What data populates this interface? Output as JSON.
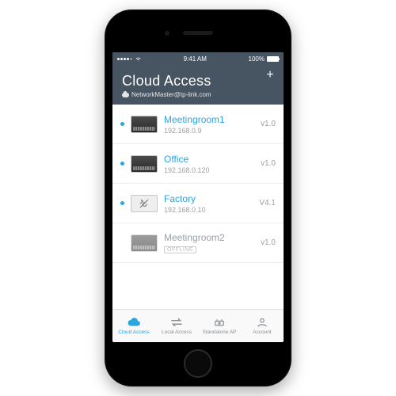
{
  "statusbar": {
    "time": "9:41 AM",
    "battery": "100%"
  },
  "header": {
    "title": "Cloud Access",
    "subtitle": "NetworkMaster@tp-link.com"
  },
  "devices": [
    {
      "name": "Meetingroom1",
      "ip": "192.168.0.9",
      "version": "v1.0",
      "online": true,
      "icon": "switch"
    },
    {
      "name": "Office",
      "ip": "192.168.0.120",
      "version": "v1.0",
      "online": true,
      "icon": "switch"
    },
    {
      "name": "Factory",
      "ip": "192.168.0.10",
      "version": "V4.1",
      "online": true,
      "icon": "tool"
    },
    {
      "name": "Meetingroom2",
      "ip": "OFFLINE",
      "version": "v1.0",
      "online": false,
      "icon": "switch"
    }
  ],
  "tabs": [
    {
      "label": "Cloud Access",
      "icon": "cloud",
      "active": true
    },
    {
      "label": "Local Access",
      "icon": "swap",
      "active": false
    },
    {
      "label": "Standalone AP",
      "icon": "ap",
      "active": false
    },
    {
      "label": "Account",
      "icon": "user",
      "active": false
    }
  ],
  "colors": {
    "accent": "#2aa5e0",
    "header": "#475461"
  }
}
